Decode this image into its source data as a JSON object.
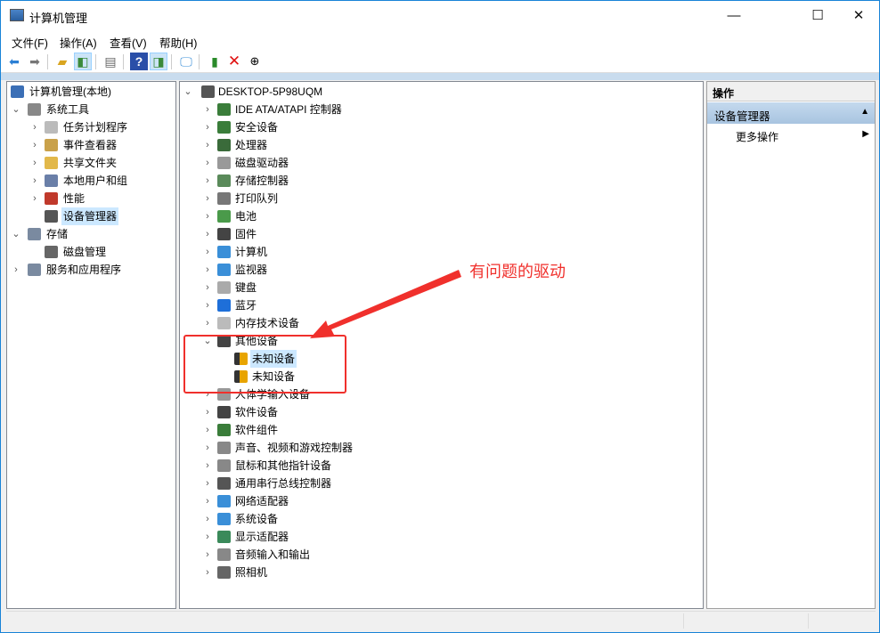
{
  "window": {
    "title": "计算机管理",
    "minimize": "—",
    "maximize": "☐",
    "close": "✕"
  },
  "menu": [
    "文件(F)",
    "操作(A)",
    "查看(V)",
    "帮助(H)"
  ],
  "left_tree": [
    {
      "label": "计算机管理(本地)",
      "level": 0,
      "chevron": "",
      "icon": "computer-management-icon",
      "color": "#3b6fb6"
    },
    {
      "label": "系统工具",
      "level": 1,
      "chevron": "⌄",
      "icon": "tools-icon",
      "color": "#888"
    },
    {
      "label": "任务计划程序",
      "level": 2,
      "chevron": "›",
      "icon": "clock-icon",
      "color": "#bbb"
    },
    {
      "label": "事件查看器",
      "level": 2,
      "chevron": "›",
      "icon": "event-viewer-icon",
      "color": "#c9a14a"
    },
    {
      "label": "共享文件夹",
      "level": 2,
      "chevron": "›",
      "icon": "shared-folder-icon",
      "color": "#e2b84a"
    },
    {
      "label": "本地用户和组",
      "level": 2,
      "chevron": "›",
      "icon": "users-icon",
      "color": "#6a7fa8"
    },
    {
      "label": "性能",
      "level": 2,
      "chevron": "›",
      "icon": "performance-icon",
      "color": "#c0392b"
    },
    {
      "label": "设备管理器",
      "level": 2,
      "chevron": "",
      "icon": "device-manager-icon",
      "color": "#555",
      "selected": true
    },
    {
      "label": "存储",
      "level": 1,
      "chevron": "⌄",
      "icon": "storage-icon",
      "color": "#7a8aa0"
    },
    {
      "label": "磁盘管理",
      "level": 2,
      "chevron": "",
      "icon": "disk-management-icon",
      "color": "#666"
    },
    {
      "label": "服务和应用程序",
      "level": 1,
      "chevron": "›",
      "icon": "services-icon",
      "color": "#7a8aa0"
    }
  ],
  "device_tree": [
    {
      "label": "DESKTOP-5P98UQM",
      "level": 0,
      "chevron": "⌄",
      "icon": "computer-icon",
      "color": "#555"
    },
    {
      "label": "IDE ATA/ATAPI 控制器",
      "level": 1,
      "chevron": "›",
      "icon": "ide-controller-icon",
      "color": "#3a7d3a"
    },
    {
      "label": "安全设备",
      "level": 1,
      "chevron": "›",
      "icon": "security-device-icon",
      "color": "#3a7d3a"
    },
    {
      "label": "处理器",
      "level": 1,
      "chevron": "›",
      "icon": "processor-icon",
      "color": "#3a6b3a"
    },
    {
      "label": "磁盘驱动器",
      "level": 1,
      "chevron": "›",
      "icon": "disk-drive-icon",
      "color": "#999"
    },
    {
      "label": "存储控制器",
      "level": 1,
      "chevron": "›",
      "icon": "storage-controller-icon",
      "color": "#5a8a5a"
    },
    {
      "label": "打印队列",
      "level": 1,
      "chevron": "›",
      "icon": "printer-icon",
      "color": "#777"
    },
    {
      "label": "电池",
      "level": 1,
      "chevron": "›",
      "icon": "battery-icon",
      "color": "#4a9a4a"
    },
    {
      "label": "固件",
      "level": 1,
      "chevron": "›",
      "icon": "firmware-icon",
      "color": "#444"
    },
    {
      "label": "计算机",
      "level": 1,
      "chevron": "›",
      "icon": "computer-icon",
      "color": "#3a8fd8"
    },
    {
      "label": "监视器",
      "level": 1,
      "chevron": "›",
      "icon": "monitor-icon",
      "color": "#3a8fd8"
    },
    {
      "label": "键盘",
      "level": 1,
      "chevron": "›",
      "icon": "keyboard-icon",
      "color": "#aaa"
    },
    {
      "label": "蓝牙",
      "level": 1,
      "chevron": "›",
      "icon": "bluetooth-icon",
      "color": "#1e6fd9"
    },
    {
      "label": "内存技术设备",
      "level": 1,
      "chevron": "›",
      "icon": "memory-device-icon",
      "color": "#bbb"
    },
    {
      "label": "其他设备",
      "level": 1,
      "chevron": "⌄",
      "icon": "other-devices-icon",
      "color": "#444"
    },
    {
      "label": "未知设备",
      "level": 2,
      "chevron": "",
      "icon": "unknown-device-warning-icon",
      "color": "#e8a400",
      "selected": true
    },
    {
      "label": "未知设备",
      "level": 2,
      "chevron": "",
      "icon": "unknown-device-warning-icon",
      "color": "#e8a400"
    },
    {
      "label": "人体学输入设备",
      "level": 1,
      "chevron": "›",
      "icon": "hid-icon",
      "color": "#999"
    },
    {
      "label": "软件设备",
      "level": 1,
      "chevron": "›",
      "icon": "software-device-icon",
      "color": "#444"
    },
    {
      "label": "软件组件",
      "level": 1,
      "chevron": "›",
      "icon": "software-component-icon",
      "color": "#3a7d3a"
    },
    {
      "label": "声音、视频和游戏控制器",
      "level": 1,
      "chevron": "›",
      "icon": "sound-icon",
      "color": "#888"
    },
    {
      "label": "鼠标和其他指针设备",
      "level": 1,
      "chevron": "›",
      "icon": "mouse-icon",
      "color": "#888"
    },
    {
      "label": "通用串行总线控制器",
      "level": 1,
      "chevron": "›",
      "icon": "usb-icon",
      "color": "#555"
    },
    {
      "label": "网络适配器",
      "level": 1,
      "chevron": "›",
      "icon": "network-adapter-icon",
      "color": "#3a8fd8"
    },
    {
      "label": "系统设备",
      "level": 1,
      "chevron": "›",
      "icon": "system-device-icon",
      "color": "#3a8fd8"
    },
    {
      "label": "显示适配器",
      "level": 1,
      "chevron": "›",
      "icon": "display-adapter-icon",
      "color": "#3a8a5a"
    },
    {
      "label": "音频输入和输出",
      "level": 1,
      "chevron": "›",
      "icon": "audio-icon",
      "color": "#888"
    },
    {
      "label": "照相机",
      "level": 1,
      "chevron": "›",
      "icon": "camera-icon",
      "color": "#666"
    }
  ],
  "actions": {
    "header": "操作",
    "section": "设备管理器",
    "section_arrow": "▲",
    "more": "更多操作",
    "more_arrow": "▶"
  },
  "annotation": {
    "text": "有问题的驱动",
    "color": "#f0302c"
  }
}
